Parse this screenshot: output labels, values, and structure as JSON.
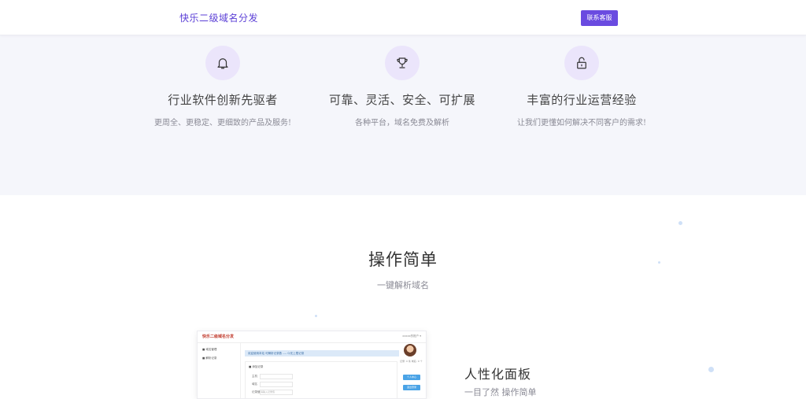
{
  "header": {
    "brand": "快乐二级域名分发",
    "contact_button": "联系客服"
  },
  "features": [
    {
      "icon": "bell-icon",
      "title": "行业软件创新先驱者",
      "desc": "更周全、更稳定、更细致的产品及服务!"
    },
    {
      "icon": "trophy-icon",
      "title": "可靠、灵活、安全、可扩展",
      "desc": "各种平台，域名免费及解析"
    },
    {
      "icon": "lock-icon",
      "title": "丰富的行业运营经验",
      "desc": "让我们更懂如何解决不同客户的需求!"
    }
  ],
  "section": {
    "title": "操作简单",
    "subtitle": "一键解析域名"
  },
  "preview": {
    "brand": "快乐二级域名分发",
    "user_menu": "xxxxx的账户 ▾",
    "side_items": [
      "■ 域名管理",
      "■ 解析记录"
    ],
    "notice_bar": "欢迎使用本站  可解析记录数 ----  0/无上限记录",
    "panel_label": "■ 添加记录",
    "rows": [
      {
        "label": "主机",
        "value": ""
      },
      {
        "label": "域名",
        "value": ""
      },
      {
        "label": "记录值",
        "value": "请输入记录值"
      }
    ],
    "stats": "记录: 0 条   域名: 0 个",
    "buttons": [
      "个人中心",
      "退出登录"
    ]
  },
  "card": {
    "title": "人性化面板",
    "desc": "一目了然  操作简单"
  },
  "colors": {
    "brand": "#5b3fd6",
    "button": "#6a4be0",
    "band": "#f5f6fb",
    "icon_circle": "#ebe5fb"
  }
}
